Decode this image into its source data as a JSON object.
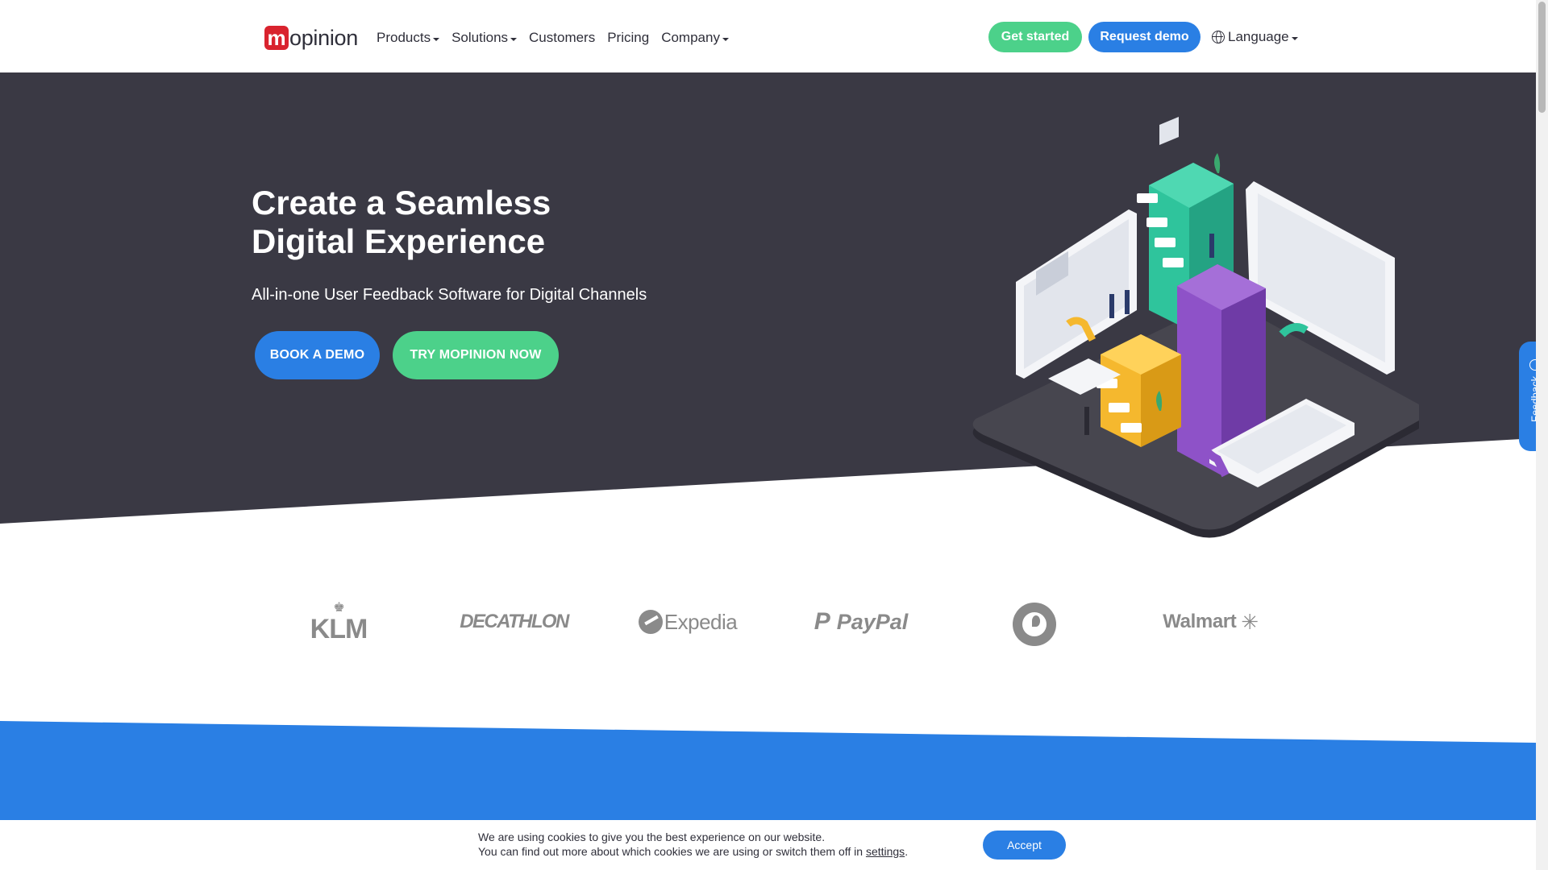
{
  "header": {
    "logo_mark": "m",
    "logo_text": "opinion",
    "nav": [
      "Products",
      "Solutions",
      "Customers",
      "Pricing",
      "Company"
    ],
    "get_started": "Get started",
    "request_demo": "Request demo",
    "language": "Language"
  },
  "hero": {
    "title_line1": "Create a Seamless",
    "title_line2": "Digital Experience",
    "subtitle": "All-in-one User Feedback Software for Digital Channels",
    "book_demo": "BOOK A DEMO",
    "try_now": "TRY MOPINION NOW"
  },
  "feedback_tab": {
    "label": "Feedback"
  },
  "logos": {
    "klm": "KLM",
    "decathlon": "DECATHLON",
    "expedia": "Expedia",
    "paypal": "PayPal",
    "paypal_mark": "P",
    "walmart": "Walmart"
  },
  "cookie": {
    "line1": "We are using cookies to give you the best experience on our website.",
    "line2_prefix": "You can find out more about which cookies we are using or switch them off in ",
    "settings_link": "settings",
    "line2_suffix": ".",
    "accept": "Accept"
  },
  "colors": {
    "hero_bg": "#3a3944",
    "primary_blue": "#2a7fe4",
    "green": "#4cd18a",
    "brand_red": "#d9232e"
  }
}
